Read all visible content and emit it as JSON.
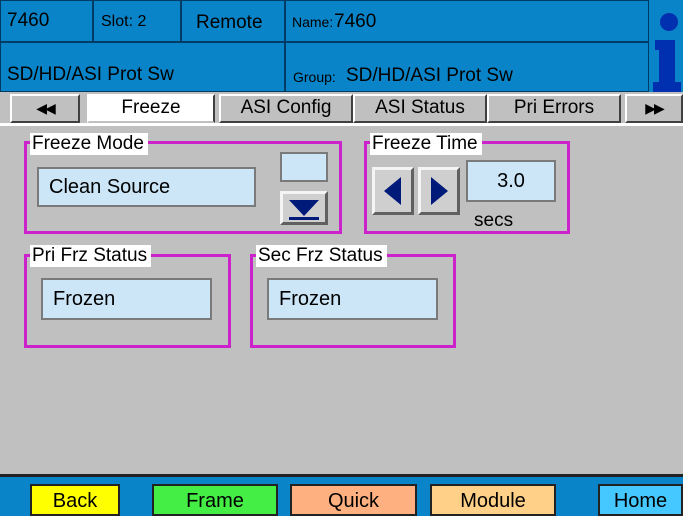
{
  "header": {
    "frame_id": "7460",
    "slot_label": "Slot: 2",
    "mode": "Remote",
    "name_key": "Name:",
    "name_value": "7460",
    "module_type": "SD/HD/ASI Prot Sw",
    "group_key": "Group:",
    "group_value": "SD/HD/ASI Prot Sw",
    "info_icon": "info-icon"
  },
  "tabs": {
    "scroll_left": "◀◀",
    "scroll_right": "▶▶",
    "items": [
      {
        "label": "Freeze",
        "active": true
      },
      {
        "label": "ASI Config",
        "active": false
      },
      {
        "label": "ASI Status",
        "active": false
      },
      {
        "label": "Pri Errors",
        "active": false
      }
    ]
  },
  "freeze_mode": {
    "title": "Freeze Mode",
    "value": "Clean Source",
    "dropdown_icon": "triangle-down-icon"
  },
  "freeze_time": {
    "title": "Freeze Time",
    "value": "3.0",
    "unit": "secs",
    "decrement_icon": "triangle-left-icon",
    "increment_icon": "triangle-right-icon"
  },
  "pri_frz_status": {
    "title": "Pri Frz Status",
    "value": "Frozen"
  },
  "sec_frz_status": {
    "title": "Sec Frz Status",
    "value": "Frozen"
  },
  "bottom": {
    "back": "Back",
    "frame": "Frame",
    "quick": "Quick",
    "module": "Module",
    "home": "Home"
  },
  "colors": {
    "header_bg": "#0a84c8",
    "panel_border": "#cc22cc",
    "field_bg": "#cce6f8",
    "back_btn": "#ffff00",
    "frame_btn": "#44ee44",
    "quick_btn": "#ffb080",
    "module_btn": "#ffd088",
    "home_btn": "#44c8ff"
  }
}
